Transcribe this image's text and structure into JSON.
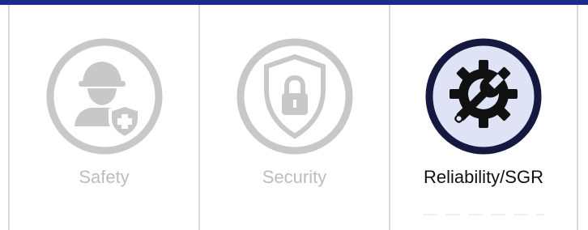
{
  "colors": {
    "top_bar": "#1f2a8c",
    "inactive_icon": "#c8c8c8",
    "inactive_text": "#bdbdbd",
    "active_ring": "#15183f",
    "active_fill": "#dfe3f5",
    "active_icon": "#111111",
    "active_text": "#111111"
  },
  "tiles": [
    {
      "label": "Safety",
      "icon": "worker-shield-icon",
      "active": false
    },
    {
      "label": "Security",
      "icon": "shield-lock-icon",
      "active": false
    },
    {
      "label": "Reliability/SGR",
      "icon": "gear-wrench-icon",
      "active": true
    }
  ]
}
